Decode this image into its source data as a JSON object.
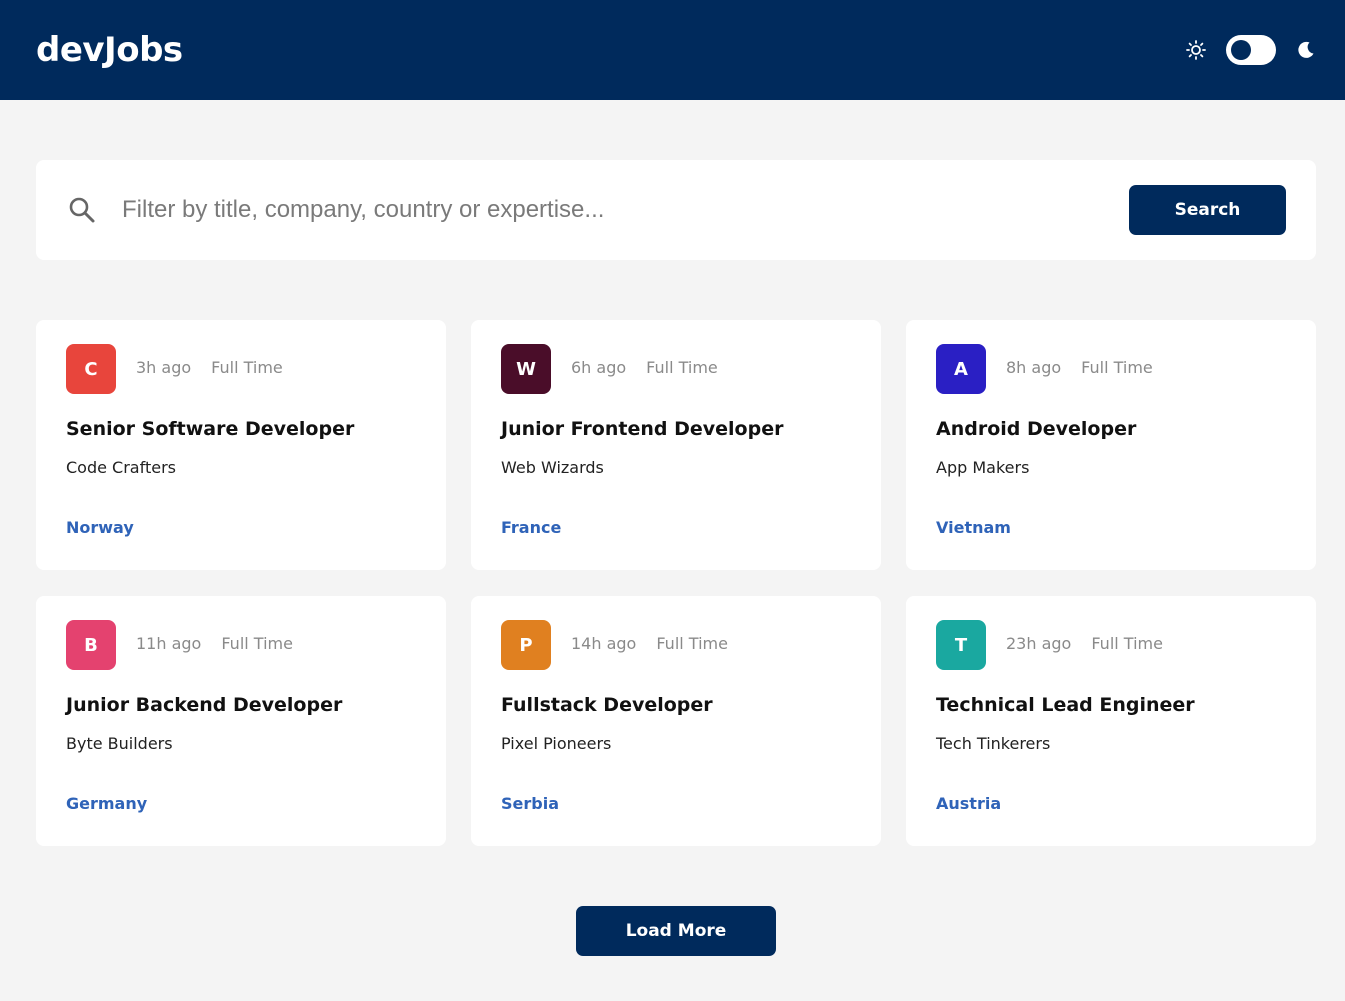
{
  "header": {
    "logo": "devJobs",
    "theme_toggle": {
      "sun_icon": "sun-icon",
      "moon_icon": "moon-icon",
      "dark_mode": false
    }
  },
  "search": {
    "placeholder": "Filter by title, company, country or expertise...",
    "value": "",
    "button_label": "Search",
    "icon": "search-icon"
  },
  "jobs": [
    {
      "logo_letter": "C",
      "logo_color": "#e8453c",
      "posted": "3h ago",
      "type": "Full Time",
      "title": "Senior Software Developer",
      "company": "Code Crafters",
      "location": "Norway"
    },
    {
      "logo_letter": "W",
      "logo_color": "#4a0d29",
      "posted": "6h ago",
      "type": "Full Time",
      "title": "Junior Frontend Developer",
      "company": "Web Wizards",
      "location": "France"
    },
    {
      "logo_letter": "A",
      "logo_color": "#2a1fc4",
      "posted": "8h ago",
      "type": "Full Time",
      "title": "Android Developer",
      "company": "App Makers",
      "location": "Vietnam"
    },
    {
      "logo_letter": "B",
      "logo_color": "#e4426f",
      "posted": "11h ago",
      "type": "Full Time",
      "title": "Junior Backend Developer",
      "company": "Byte Builders",
      "location": "Germany"
    },
    {
      "logo_letter": "P",
      "logo_color": "#e08020",
      "posted": "14h ago",
      "type": "Full Time",
      "title": "Fullstack Developer",
      "company": "Pixel Pioneers",
      "location": "Serbia"
    },
    {
      "logo_letter": "T",
      "logo_color": "#1aa8a0",
      "posted": "23h ago",
      "type": "Full Time",
      "title": "Technical Lead Engineer",
      "company": "Tech Tinkerers",
      "location": "Austria"
    }
  ],
  "load_more_label": "Load More",
  "colors": {
    "header_bg": "#002a5c",
    "accent": "#002a5c",
    "location_text": "#2f63b8",
    "page_bg": "#f4f4f4"
  }
}
